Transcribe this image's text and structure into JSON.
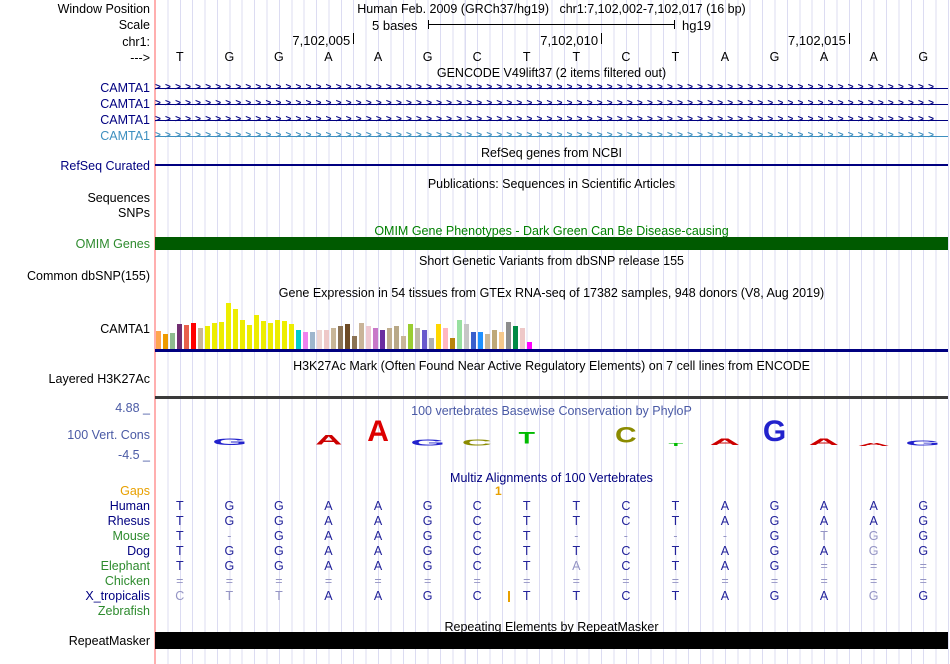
{
  "header": {
    "window_position_label": "Window Position",
    "assembly": "Human Feb. 2009 (GRCh37/hg19)",
    "position": "chr1:7,102,002-7,102,017 (16 bp)",
    "scale_label": "Scale",
    "scale_value": "5 bases",
    "scale_assembly": "hg19",
    "chrom_label": "chr1:",
    "strand_label": "--->",
    "ruler_ticks": [
      "7,102,005",
      "7,102,010",
      "7,102,015"
    ]
  },
  "sequence": [
    "T",
    "G",
    "G",
    "A",
    "A",
    "G",
    "C",
    "T",
    "T",
    "C",
    "T",
    "A",
    "G",
    "A",
    "A",
    "G"
  ],
  "tracks": {
    "gencode": {
      "title": "GENCODE V49lift37 (2 items filtered out)",
      "genes": [
        {
          "label": "CAMTA1",
          "color": "#000080"
        },
        {
          "label": "CAMTA1",
          "color": "#000080"
        },
        {
          "label": "CAMTA1",
          "color": "#000080"
        },
        {
          "label": "CAMTA1",
          "color": "#3e8fbf"
        }
      ]
    },
    "refseq": {
      "title": "RefSeq genes from NCBI",
      "label": "RefSeq Curated",
      "color": "#000080"
    },
    "publications": {
      "title": "Publications: Sequences in Scientific Articles",
      "label": "Sequences"
    },
    "snps_label": "SNPs",
    "omim": {
      "title": "OMIM Gene Phenotypes - Dark Green Can Be Disease-causing",
      "label": "OMIM Genes",
      "title_color": "#008000",
      "bar_color": "#005a00"
    },
    "dbsnp": {
      "title": "Short Genetic Variants from dbSNP release 155",
      "label": "Common dbSNP(155)"
    },
    "gtex": {
      "title": "Gene Expression in 54 tissues from GTEx RNA-seq of 17382 samples, 948 donors (V8, Aug 2019)",
      "label": "CAMTA1",
      "baseline_color": "#000080",
      "bars": [
        {
          "color": "#FFA54F",
          "h": 18
        },
        {
          "color": "#EE9A00",
          "h": 15
        },
        {
          "color": "#8FBC8F",
          "h": 16
        },
        {
          "color": "#722F72",
          "h": 25
        },
        {
          "color": "#E8604C",
          "h": 24
        },
        {
          "color": "#FF0000",
          "h": 26
        },
        {
          "color": "#C8B698",
          "h": 21
        },
        {
          "color": "#EDED00",
          "h": 23
        },
        {
          "color": "#EDED00",
          "h": 26
        },
        {
          "color": "#EDED00",
          "h": 27
        },
        {
          "color": "#EDED00",
          "h": 46
        },
        {
          "color": "#EDED00",
          "h": 40
        },
        {
          "color": "#EDED00",
          "h": 29
        },
        {
          "color": "#EDED00",
          "h": 24
        },
        {
          "color": "#EDED00",
          "h": 34
        },
        {
          "color": "#EDED00",
          "h": 28
        },
        {
          "color": "#EDED00",
          "h": 26
        },
        {
          "color": "#EDED00",
          "h": 29
        },
        {
          "color": "#EDED00",
          "h": 28
        },
        {
          "color": "#EDED00",
          "h": 25
        },
        {
          "color": "#00CDCD",
          "h": 19
        },
        {
          "color": "#EE82EE",
          "h": 17
        },
        {
          "color": "#9FB6CD",
          "h": 17
        },
        {
          "color": "#EED5D2",
          "h": 19
        },
        {
          "color": "#EEC8C8",
          "h": 19
        },
        {
          "color": "#C8B698",
          "h": 21
        },
        {
          "color": "#8B7355",
          "h": 23
        },
        {
          "color": "#6E4B26",
          "h": 25
        },
        {
          "color": "#8B7355",
          "h": 13
        },
        {
          "color": "#C9B499",
          "h": 26
        },
        {
          "color": "#EEC8D2",
          "h": 23
        },
        {
          "color": "#C878C8",
          "h": 21
        },
        {
          "color": "#6A2DA0",
          "h": 19
        },
        {
          "color": "#C0AE8E",
          "h": 21
        },
        {
          "color": "#B8A888",
          "h": 23
        },
        {
          "color": "#C8B698",
          "h": 13
        },
        {
          "color": "#9ACD32",
          "h": 25
        },
        {
          "color": "#BEB8A8",
          "h": 21
        },
        {
          "color": "#6959CD",
          "h": 19
        },
        {
          "color": "#B0B0B0",
          "h": 11
        },
        {
          "color": "#FFD700",
          "h": 25
        },
        {
          "color": "#FFB6C1",
          "h": 21
        },
        {
          "color": "#B8860B",
          "h": 11
        },
        {
          "color": "#98E0A0",
          "h": 29
        },
        {
          "color": "#C6C6C6",
          "h": 25
        },
        {
          "color": "#3A5FCD",
          "h": 17
        },
        {
          "color": "#1E90FF",
          "h": 17
        },
        {
          "color": "#C8B698",
          "h": 15
        },
        {
          "color": "#BFA878",
          "h": 19
        },
        {
          "color": "#F5C88C",
          "h": 17
        },
        {
          "color": "#8E8E8E",
          "h": 27
        },
        {
          "color": "#008B45",
          "h": 23
        },
        {
          "color": "#EEC8C8",
          "h": 21
        },
        {
          "color": "#FF00FF",
          "h": 7
        }
      ]
    },
    "h3k27ac": {
      "title": "H3K27Ac Mark (Often Found Near Active Regulatory Elements) on 7 cell lines from ENCODE",
      "label": "Layered H3K27Ac",
      "baseline_color": "#3a3a3a"
    },
    "phylop": {
      "title": "100 vertebrates Basewise Conservation by PhyloP",
      "label": "100 Vert. Cons",
      "max_label": "4.88 _",
      "min_label": "-4.5 _",
      "logo": [
        null,
        {
          "ch": "G",
          "color": "#2222CC",
          "sy": 0.3,
          "sx": 1.5
        },
        null,
        {
          "ch": "A",
          "color": "#CC0000",
          "sy": 0.45,
          "sx": 1.25
        },
        {
          "ch": "A",
          "color": "#DD0000",
          "sy": 1.0,
          "sx": 1.0
        },
        {
          "ch": "G",
          "color": "#2222CC",
          "sy": 0.28,
          "sx": 1.5
        },
        {
          "ch": "C",
          "color": "#8B8B00",
          "sy": 0.28,
          "sx": 1.4
        },
        {
          "ch": "T",
          "color": "#00BB00",
          "sy": 0.55,
          "sx": 0.9
        },
        null,
        {
          "ch": "C",
          "color": "#8B8B00",
          "sy": 0.75,
          "sx": 1.0
        },
        {
          "ch": "T",
          "color": "#00BB00",
          "sy": 0.14,
          "sx": 0.8
        },
        {
          "ch": "A",
          "color": "#CC0000",
          "sy": 0.3,
          "sx": 1.4
        },
        {
          "ch": "G",
          "color": "#2222CC",
          "sy": 1.0,
          "sx": 1.0
        },
        {
          "ch": "A",
          "color": "#CC0000",
          "sy": 0.3,
          "sx": 1.4
        },
        {
          "ch": "A",
          "color": "#CC0000",
          "sy": 0.15,
          "sx": 1.5
        },
        {
          "ch": "G",
          "color": "#2222CC",
          "sy": 0.25,
          "sx": 1.5
        }
      ]
    },
    "multiz": {
      "title": "Multiz Alignments of 100 Vertebrates",
      "gaps_label": "Gaps",
      "insertion_count": "1",
      "rows": [
        {
          "name": "Human",
          "label_color": "navy",
          "cells": [
            "T",
            "G",
            "G",
            "A",
            "A",
            "G",
            "C",
            "T",
            "T",
            "C",
            "T",
            "A",
            "G",
            "A",
            "A",
            "G"
          ]
        },
        {
          "name": "Rhesus",
          "label_color": "navy",
          "cells": [
            "T",
            "G",
            "G",
            "A",
            "A",
            "G",
            "C",
            "T",
            "T",
            "C",
            "T",
            "A",
            "G",
            "A",
            "A",
            "G"
          ]
        },
        {
          "name": "Mouse",
          "label_color": "green",
          "cells": [
            "T",
            "-",
            "G",
            "A",
            "A",
            "G",
            "C",
            "T",
            "-",
            "-",
            "-",
            "-",
            "G",
            "t",
            "g",
            "G"
          ]
        },
        {
          "name": "Dog",
          "label_color": "navy",
          "cells": [
            "T",
            "G",
            "G",
            "A",
            "A",
            "G",
            "C",
            "T",
            "T",
            "C",
            "T",
            "A",
            "G",
            "A",
            "g",
            "G"
          ]
        },
        {
          "name": "Elephant",
          "label_color": "green",
          "cells": [
            "T",
            "G",
            "G",
            "A",
            "A",
            "G",
            "C",
            "T",
            "a",
            "C",
            "T",
            "A",
            "G",
            "=",
            "=",
            "="
          ]
        },
        {
          "name": "Chicken",
          "label_color": "green",
          "cells": [
            "=",
            "=",
            "=",
            "=",
            "=",
            "=",
            "=",
            "=",
            "=",
            "=",
            "=",
            "=",
            "=",
            "=",
            "=",
            "="
          ]
        },
        {
          "name": "X_tropicalis",
          "label_color": "navy",
          "cells": [
            "c",
            "t",
            "t",
            "A",
            "A",
            "G",
            "C",
            "T",
            "T",
            "C",
            "T",
            "A",
            "G",
            "A",
            "g",
            "G"
          ],
          "insertion": true
        },
        {
          "name": "Zebrafish",
          "label_color": "green",
          "cells": [
            "",
            "",
            "",
            "",
            "",
            "",
            "",
            "",
            "",
            "",
            "",
            "",
            "",
            "",
            "",
            ""
          ]
        }
      ]
    },
    "repeatmasker": {
      "title": "Repeating Elements by RepeatMasker",
      "label": "RepeatMasker",
      "bar_color": "#000000"
    }
  }
}
